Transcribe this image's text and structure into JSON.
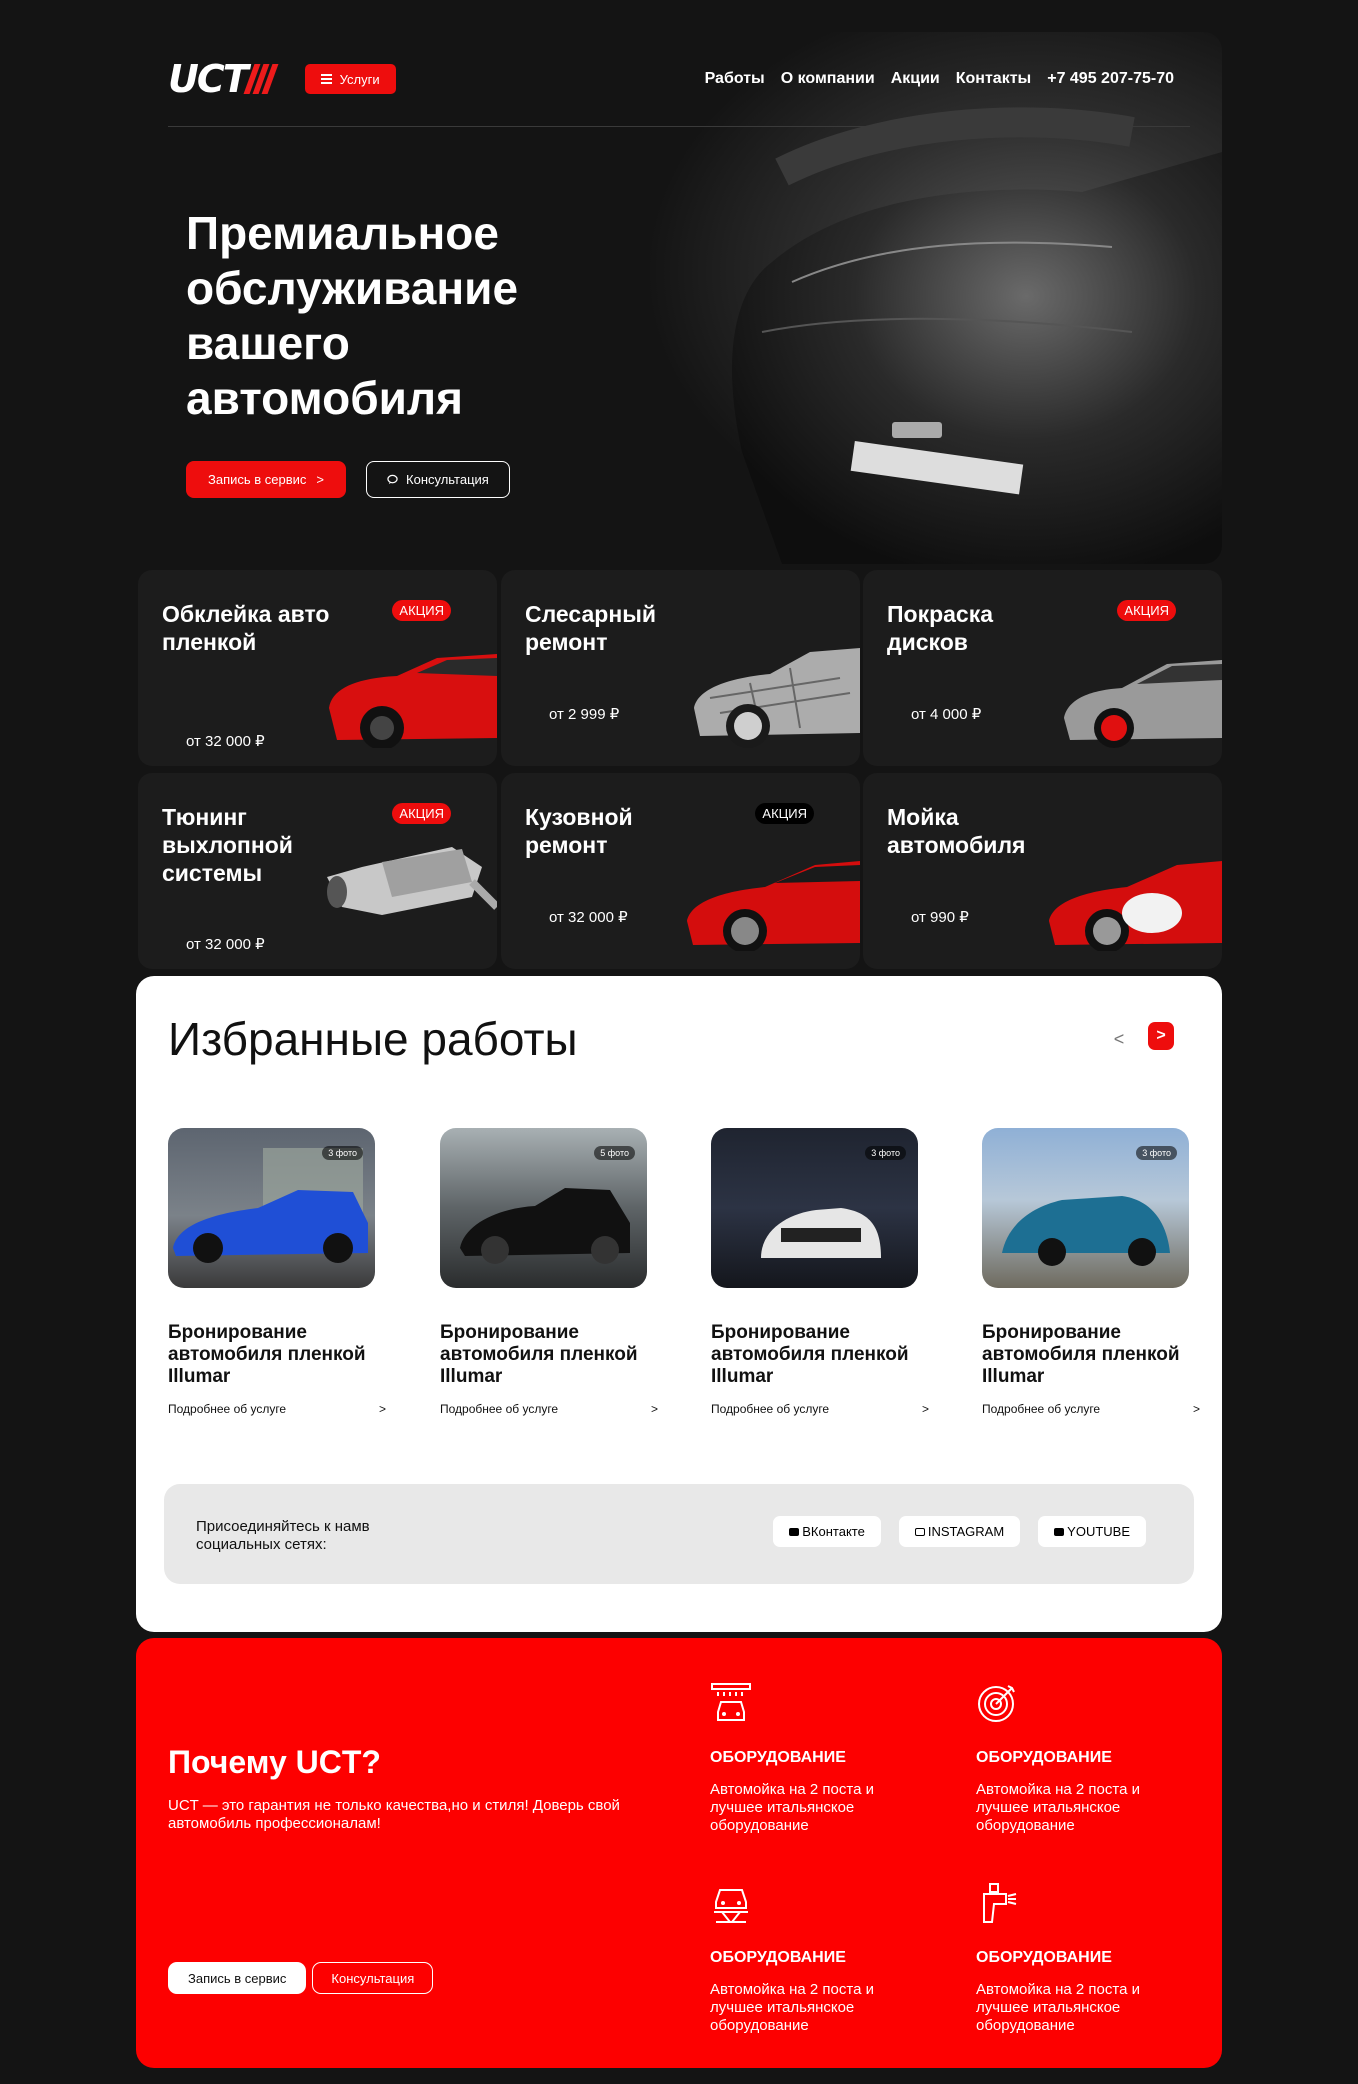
{
  "header": {
    "logo": "UCT",
    "services_button": "Услуги",
    "nav": [
      "Работы",
      "О компании",
      "Акции",
      "Контакты",
      "+7 495 207-75-70"
    ]
  },
  "hero": {
    "title": "Премиальное обслуживание вашего автомобиля",
    "primary_button": "Запись в сервис",
    "primary_arrow": ">",
    "secondary_button": "Консультация"
  },
  "services": [
    {
      "title": "Обклейка авто пленкой",
      "price": "от 32 000 ₽",
      "badge": "АКЦИЯ"
    },
    {
      "title": "Слесарный ремонт",
      "price": "от 2 999 ₽",
      "badge": ""
    },
    {
      "title": "Покраска дисков",
      "price": "от 4 000 ₽",
      "badge": "АКЦИЯ"
    },
    {
      "title": "Тюнинг выхлопной системы",
      "price": "от 32 000 ₽",
      "badge": "АКЦИЯ"
    },
    {
      "title": "Кузовной ремонт",
      "price": "от 32 000 ₽",
      "badge": "АКЦИЯ"
    },
    {
      "title": "Мойка автомобиля",
      "price": "от 990 ₽",
      "badge": ""
    }
  ],
  "works": {
    "title": "Избранные работы",
    "prev": "<",
    "next": ">",
    "cards": [
      {
        "photos": "3 фото",
        "title": "Бронирование автомобиля пленкой Illumar",
        "more": "Подробнее об услуге",
        "arrow": ">"
      },
      {
        "photos": "5 фото",
        "title": "Бронирование автомобиля пленкой Illumar",
        "more": "Подробнее об услуге",
        "arrow": ">"
      },
      {
        "photos": "3 фото",
        "title": "Бронирование автомобиля пленкой Illumar",
        "more": "Подробнее об услуге",
        "arrow": ">"
      },
      {
        "photos": "3 фото",
        "title": "Бронирование автомобиля пленкой Illumar",
        "more": "Подробнее об услуге",
        "arrow": ">"
      }
    ],
    "social": {
      "text": "Присоединяйтесь к намв социальных сетях:",
      "buttons": [
        "ВКонтакте",
        "INSTAGRAM",
        "YOUTUBE"
      ]
    }
  },
  "why": {
    "title": "Почему UCT?",
    "text": "UCT — это гарантия не только качества,но и стиля! Доверь свой автомобиль профессионалам!",
    "primary_button": "Запись в сервис",
    "secondary_button": "Консультация",
    "features": [
      {
        "title": "ОБОРУДОВАНИЕ",
        "text": "Автомойка на 2 поста и лучшее итальянское оборудование",
        "icon": "car-wash-icon"
      },
      {
        "title": "ОБОРУДОВАНИЕ",
        "text": "Автомойка на 2 поста и лучшее итальянское оборудование",
        "icon": "target-icon"
      },
      {
        "title": "ОБОРУДОВАНИЕ",
        "text": "Автомойка на 2 поста и лучшее итальянское оборудование",
        "icon": "car-lift-icon"
      },
      {
        "title": "ОБОРУДОВАНИЕ",
        "text": "Автомойка на 2 поста и лучшее итальянское оборудование",
        "icon": "spray-gun-icon"
      }
    ]
  },
  "colors": {
    "accent": "#ee0d0d",
    "background": "#141414",
    "card": "#1c1c1c",
    "why_bg": "#fd0000"
  }
}
